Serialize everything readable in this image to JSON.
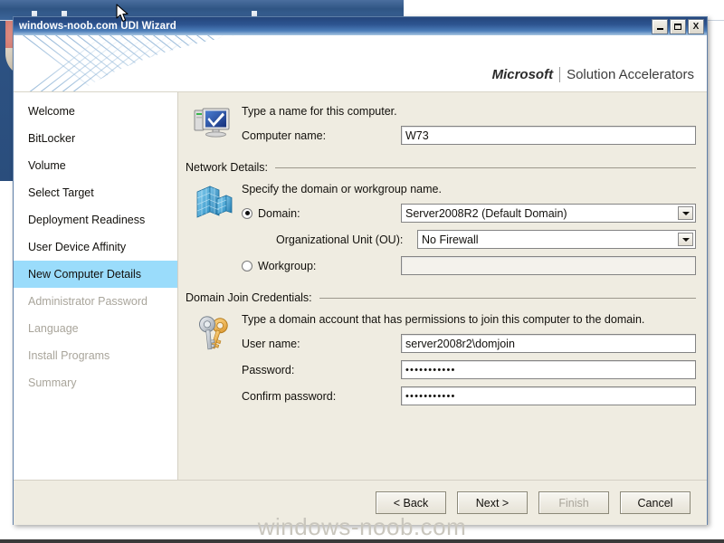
{
  "window": {
    "title": "windows-noob.com UDI Wizard",
    "controls": {
      "minimize": "minimize-button",
      "maximize": "maximize-button",
      "close_label": "X"
    }
  },
  "banner": {
    "brand_primary": "Microsoft",
    "brand_secondary": "Solution Accelerators"
  },
  "sidebar": {
    "items": [
      {
        "label": "Welcome",
        "state": "normal"
      },
      {
        "label": "BitLocker",
        "state": "normal"
      },
      {
        "label": "Volume",
        "state": "normal"
      },
      {
        "label": "Select Target",
        "state": "normal"
      },
      {
        "label": "Deployment Readiness",
        "state": "normal"
      },
      {
        "label": "User Device Affinity",
        "state": "normal"
      },
      {
        "label": "New Computer Details",
        "state": "selected"
      },
      {
        "label": "Administrator Password",
        "state": "disabled"
      },
      {
        "label": "Language",
        "state": "disabled"
      },
      {
        "label": "Install Programs",
        "state": "disabled"
      },
      {
        "label": "Summary",
        "state": "disabled"
      }
    ],
    "selected_color": "#9adcfb"
  },
  "main": {
    "computer": {
      "lead": "Type a name for this computer.",
      "name_label": "Computer name:",
      "name_value": "W73"
    },
    "network": {
      "group_title": "Network Details:",
      "lead": "Specify the domain or workgroup name.",
      "domain_label": "Domain:",
      "domain_value": "Server2008R2 (Default Domain)",
      "domain_selected": true,
      "ou_label": "Organizational Unit (OU):",
      "ou_value": "No Firewall",
      "workgroup_label": "Workgroup:",
      "workgroup_value": "",
      "workgroup_selected": false
    },
    "credentials": {
      "group_title": "Domain Join Credentials:",
      "lead": "Type a domain account that has permissions to join this computer to the domain.",
      "username_label": "User name:",
      "username_value": "server2008r2\\domjoin",
      "password_label": "Password:",
      "password_value": "•••••••••••",
      "confirm_label": "Confirm password:",
      "confirm_value": "•••••••••••"
    }
  },
  "footer": {
    "back": "< Back",
    "next": "Next >",
    "finish": "Finish",
    "cancel": "Cancel",
    "finish_disabled": true
  },
  "watermark": {
    "text": "windows-noob.com"
  }
}
